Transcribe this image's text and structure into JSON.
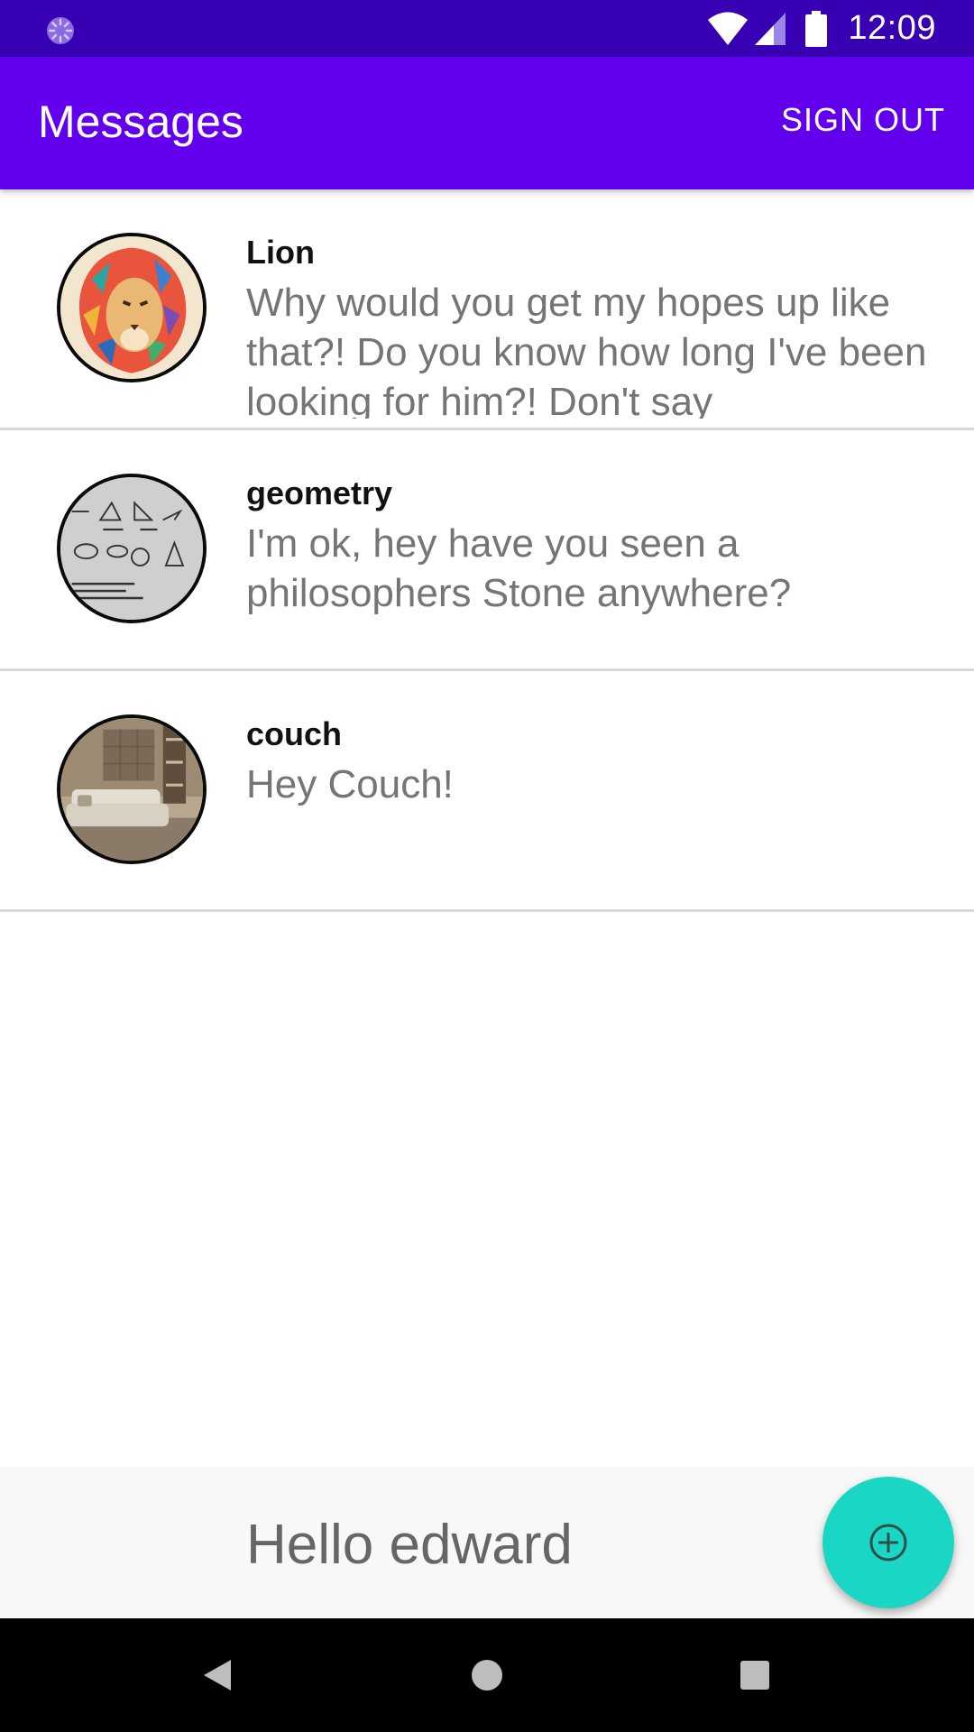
{
  "status_bar": {
    "time": "12:09",
    "icons": [
      "loading-circle-icon",
      "wifi-icon",
      "signal-icon",
      "battery-icon"
    ]
  },
  "app_bar": {
    "title": "Messages",
    "sign_out_label": "SIGN OUT"
  },
  "conversations": [
    {
      "name": "Lion",
      "message": "Why would you get my hopes up like that?! Do you know how long I've been looking for him?! Don't say",
      "avatar": "lion-avatar"
    },
    {
      "name": "geometry",
      "message": "I'm ok, hey have you seen a philosophers Stone anywhere?",
      "avatar": "geometry-avatar"
    },
    {
      "name": "couch",
      "message": "Hey Couch!",
      "avatar": "couch-avatar"
    }
  ],
  "greeting": "Hello edward",
  "fab": {
    "icon": "add-circle-icon"
  },
  "navigation": {
    "buttons": [
      "back-icon",
      "home-icon",
      "recents-icon"
    ]
  },
  "colors": {
    "status_bar": "#3700b3",
    "app_bar": "#6200ee",
    "fab": "#19d7c4",
    "message_text": "#757575"
  }
}
